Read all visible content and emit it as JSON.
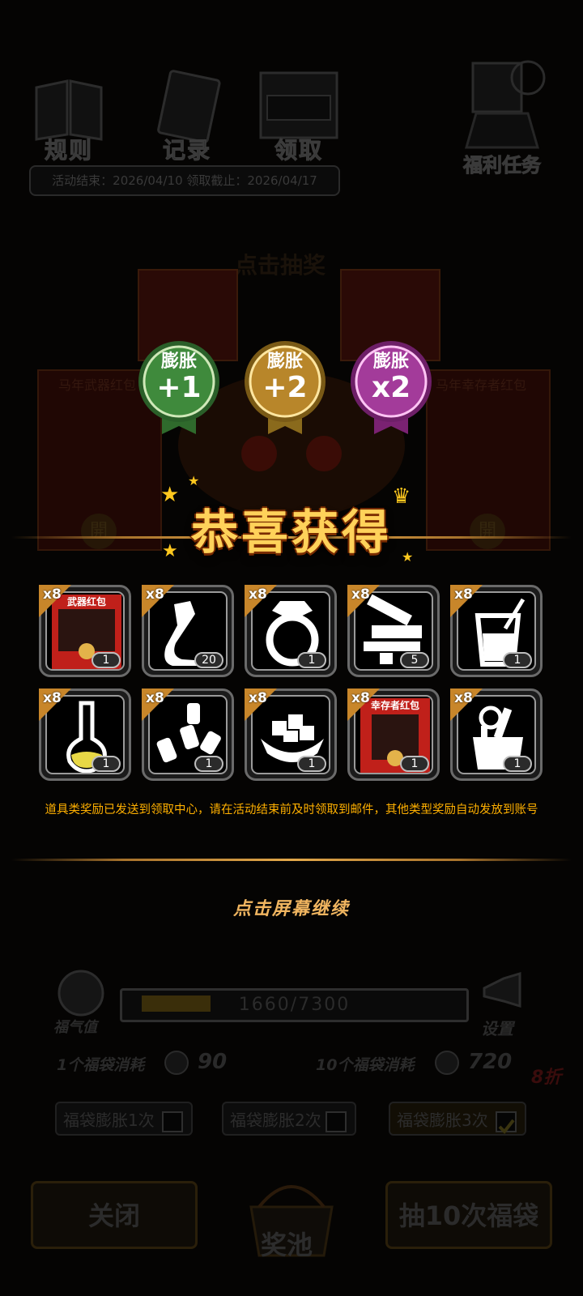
{
  "background": {
    "menu": [
      {
        "label": "规则",
        "icon": "book-icon"
      },
      {
        "label": "记录",
        "icon": "scroll-icon"
      },
      {
        "label": "领取",
        "icon": "mailbox-icon"
      }
    ],
    "welfare_label": "福利任务",
    "dates": "活动结束：2026/04/10  领取截止：2026/04/17",
    "draw_title": "点击抽奖",
    "envelope_left_title": "马年武器红包",
    "envelope_right_title": "马年幸存者红包",
    "envelope_seal": "開"
  },
  "badges": [
    {
      "top": "膨胀",
      "value": "+1",
      "color": "#3f8a3c"
    },
    {
      "top": "膨胀",
      "value": "+2",
      "color": "#b8862a"
    },
    {
      "top": "膨胀",
      "value": "x2",
      "color": "#a33b9a"
    }
  ],
  "popup": {
    "title": "恭喜获得",
    "items": [
      {
        "mult": "x8",
        "count": "1",
        "icon": "weapon-red-envelope-icon",
        "label": "武器红包"
      },
      {
        "mult": "x8",
        "count": "20",
        "icon": "glue-icon"
      },
      {
        "mult": "x8",
        "count": "1",
        "icon": "ring-icon"
      },
      {
        "mult": "x8",
        "count": "5",
        "icon": "weapon-parts-icon"
      },
      {
        "mult": "x8",
        "count": "1",
        "icon": "drink-glass-icon"
      },
      {
        "mult": "x8",
        "count": "1",
        "icon": "potion-flask-icon"
      },
      {
        "mult": "x8",
        "count": "1",
        "icon": "pills-icon"
      },
      {
        "mult": "x8",
        "count": "1",
        "icon": "sugar-cubes-icon"
      },
      {
        "mult": "x8",
        "count": "1",
        "icon": "survivor-red-envelope-icon",
        "label": "幸存者红包"
      },
      {
        "mult": "x8",
        "count": "1",
        "icon": "tool-bag-icon"
      }
    ],
    "notice": "道具类奖励已发送到领取中心，请在活动结束前及时领取到邮件，其他类型奖励自动发放到账号",
    "continue": "点击屏幕继续"
  },
  "bottom": {
    "luck_label": "福气值",
    "progress_text": "1660/7300",
    "progress_fraction": 0.227,
    "settings_label": "设置",
    "cost_one_label": "1个福袋消耗",
    "cost_one_value": "90",
    "cost_ten_label": "10个福袋消耗",
    "cost_ten_value": "720",
    "discount": "8折",
    "expand_options": [
      {
        "label": "福袋膨胀1次",
        "checked": false
      },
      {
        "label": "福袋膨胀2次",
        "checked": false
      },
      {
        "label": "福袋膨胀3次",
        "checked": true
      }
    ],
    "close_label": "关闭",
    "pool_label": "奖池",
    "draw_ten_label": "抽10次福袋"
  }
}
